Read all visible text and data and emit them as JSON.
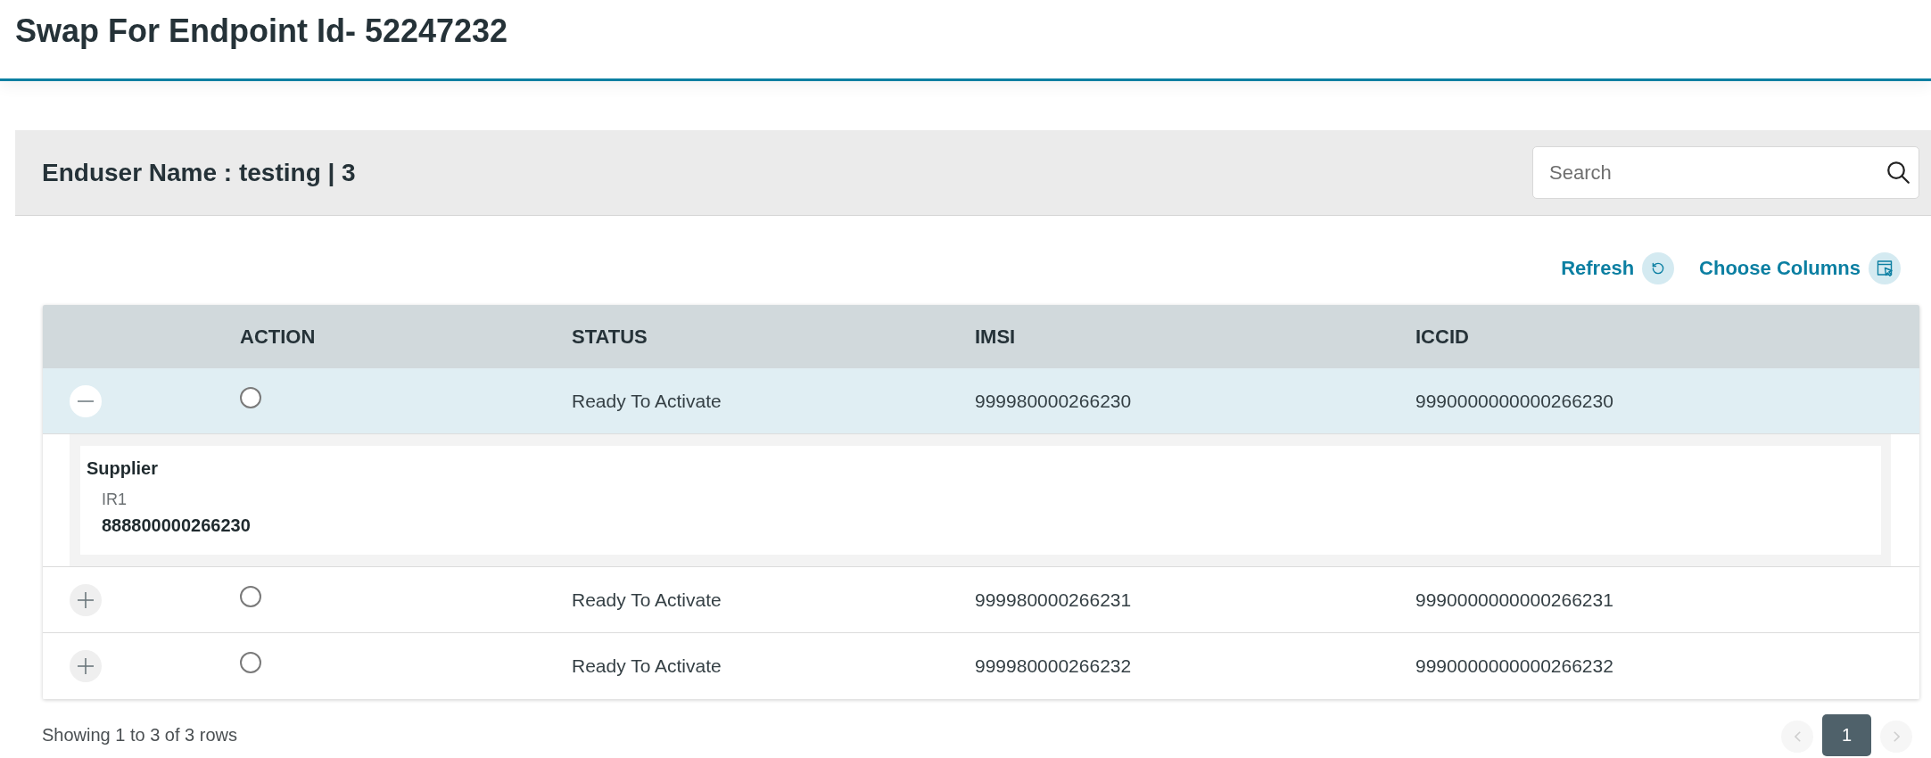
{
  "page": {
    "title": "Swap For Endpoint Id- 52247232"
  },
  "enduser_bar": {
    "title": "Enduser Name : testing | 3",
    "search": {
      "placeholder": "Search"
    }
  },
  "toolbar": [
    {
      "kind": "refresh",
      "label": "Refresh"
    },
    {
      "kind": "columns",
      "label": "Choose Columns"
    }
  ],
  "table": {
    "columns": [
      "ACTION",
      "STATUS",
      "IMSI",
      "ICCID"
    ],
    "rows": [
      {
        "expanded": true,
        "selected": false,
        "status": "Ready To Activate",
        "imsi": "999980000266230",
        "iccid": "9990000000000266230",
        "details": {
          "title": "Supplier",
          "label": "IR1",
          "value": "888800000266230"
        }
      },
      {
        "expanded": false,
        "selected": false,
        "status": "Ready To Activate",
        "imsi": "999980000266231",
        "iccid": "9990000000000266231"
      },
      {
        "expanded": false,
        "selected": false,
        "status": "Ready To Activate",
        "imsi": "999980000266232",
        "iccid": "9990000000000266232"
      }
    ]
  },
  "pagination": {
    "summary": "Showing 1 to 3 of 3 rows",
    "previous": {
      "disabled": true
    },
    "pages": [
      {
        "label": "1",
        "selected": true
      }
    ],
    "next": {
      "disabled": true
    }
  }
}
